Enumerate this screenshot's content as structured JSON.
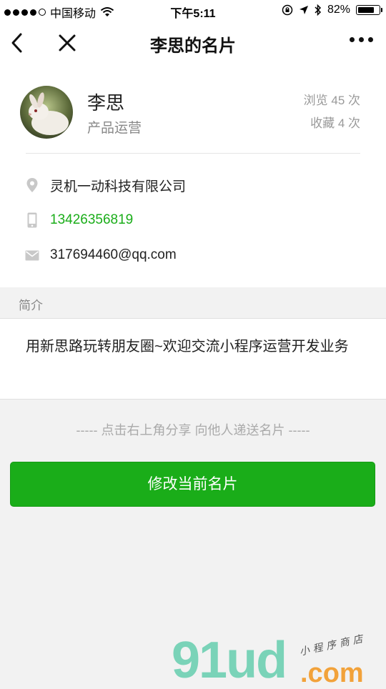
{
  "status_bar": {
    "carrier": "中国移动",
    "time": "下午5:11",
    "battery": "82%",
    "battery_level": 0.82
  },
  "navbar": {
    "title": "李思的名片"
  },
  "profile": {
    "name": "李思",
    "role": "产品运营",
    "views": "浏览 45 次",
    "favorites": "收藏 4 次"
  },
  "contact": {
    "company": "灵机一动科技有限公司",
    "phone": "13426356819",
    "email": "317694460@qq.com"
  },
  "intro": {
    "header": "简介",
    "text": "用新思路玩转朋友圈~欢迎交流小程序运营开发业务"
  },
  "share_tip": "----- 点击右上角分享 向他人递送名片 -----",
  "edit_button": "修改当前名片",
  "watermark": {
    "logo": "91ud",
    "domain": ".com",
    "tagline": "小程序商店"
  },
  "colors": {
    "accent_green": "#1aad19",
    "background": "#f2f2f2"
  }
}
